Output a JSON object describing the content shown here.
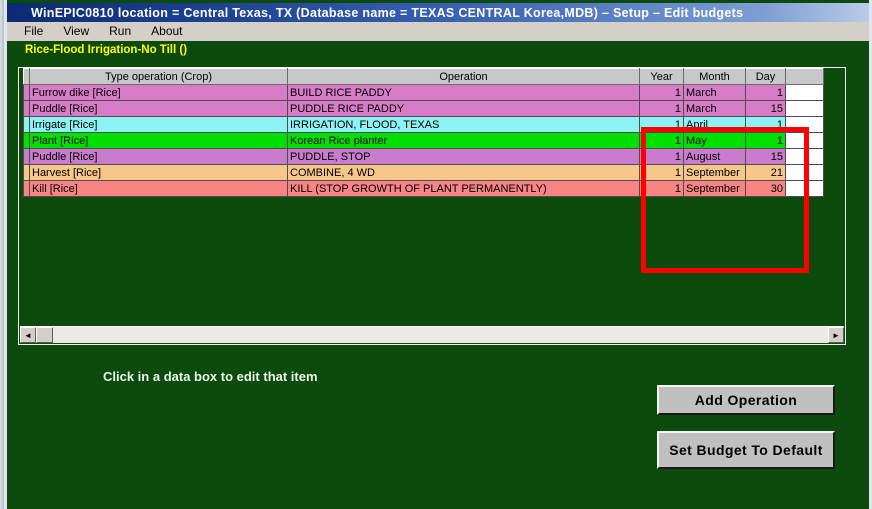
{
  "window": {
    "title": "WinEPIC0810  location = Central Texas, TX     (Database name = TEXAS CENTRAL Korea,MDB) – Setup – Edit budgets",
    "accent_title_color": "#1c3f8f",
    "client_bg_color": "#0d4a0d"
  },
  "menu": {
    "items": [
      {
        "label": "File"
      },
      {
        "label": "View"
      },
      {
        "label": "Run"
      },
      {
        "label": "About"
      }
    ]
  },
  "budget": {
    "name": "Rice-Flood Irrigation-No Till  ()",
    "name_color": "#ffff00"
  },
  "grid": {
    "columns": [
      {
        "key": "type",
        "label": "Type operation (Crop)"
      },
      {
        "key": "operation",
        "label": "Operation"
      },
      {
        "key": "year",
        "label": "Year"
      },
      {
        "key": "month",
        "label": "Month"
      },
      {
        "key": "day",
        "label": "Day"
      }
    ],
    "rows": [
      {
        "type": "Furrow dike [Rice]",
        "operation": "BUILD RICE PADDY",
        "year": "1",
        "month": "March",
        "day": "1",
        "color": "#d87cc8"
      },
      {
        "type": "Puddle [Rice]",
        "operation": "PUDDLE RICE PADDY",
        "year": "1",
        "month": "March",
        "day": "15",
        "color": "#d87cc8"
      },
      {
        "type": "Irrigate [Rice]",
        "operation": "IRRIGATION, FLOOD, TEXAS",
        "year": "1",
        "month": "April",
        "day": "1",
        "color": "#8cf2f2"
      },
      {
        "type": "Plant [Rice]",
        "operation": "Korean Rice planter",
        "year": "1",
        "month": "May",
        "day": "1",
        "color": "#00e000"
      },
      {
        "type": "Puddle [Rice]",
        "operation": "PUDDLE, STOP",
        "year": "1",
        "month": "August",
        "day": "15",
        "color": "#c87ccb"
      },
      {
        "type": "Harvest [Rice]",
        "operation": "COMBINE, 4 WD",
        "year": "1",
        "month": "September",
        "day": "21",
        "color": "#f7c68a"
      },
      {
        "type": "Kill [Rice]",
        "operation": "KILL (STOP GROWTH OF PLANT PERMANENTLY)",
        "year": "1",
        "month": "September",
        "day": "30",
        "color": "#f98484"
      }
    ],
    "scrollbar": {
      "left_arrow": "◄",
      "right_arrow": "►"
    }
  },
  "hint": {
    "text": "Click in a data box to edit that item"
  },
  "buttons": {
    "add_operation": "Add  Operation",
    "set_budget_default": "Set Budget To Default"
  },
  "annotation": {
    "highlight_color": "#ff0000",
    "highlight_target": "Year Month Day columns"
  }
}
